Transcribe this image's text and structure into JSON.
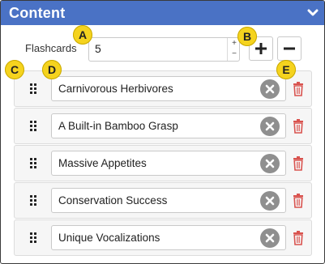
{
  "header": {
    "title": "Content",
    "collapse_icon": "chevron-down-icon"
  },
  "flashcards": {
    "label": "Flashcards",
    "value": "5",
    "increment_glyph": "+",
    "decrement_glyph": "−"
  },
  "items": [
    {
      "text": "Carnivorous Herbivores"
    },
    {
      "text": "A Built-in Bamboo Grasp"
    },
    {
      "text": "Massive Appetites"
    },
    {
      "text": "Conservation Success"
    },
    {
      "text": "Unique Vocalizations"
    }
  ],
  "callouts": {
    "a": "A",
    "b": "B",
    "c": "C",
    "d": "D",
    "e": "E"
  },
  "colors": {
    "header_bg": "#4a72c5",
    "callout": "#f5d31e",
    "delete": "#d9534f",
    "clear": "#8f8f8f"
  }
}
